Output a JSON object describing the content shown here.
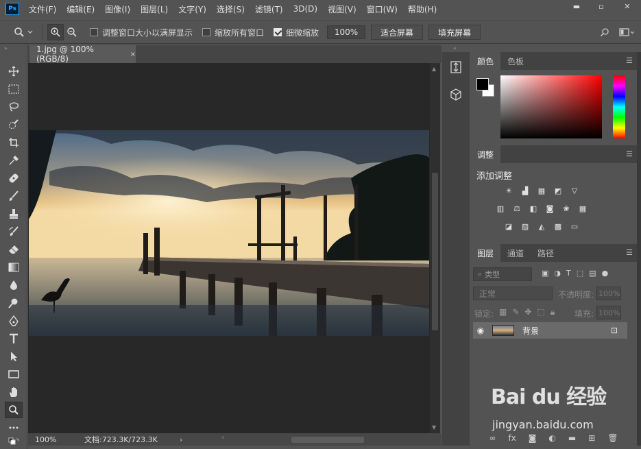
{
  "app": {
    "logo": "Ps"
  },
  "menu": [
    "文件(F)",
    "编辑(E)",
    "图像(I)",
    "图层(L)",
    "文字(Y)",
    "选择(S)",
    "滤镜(T)",
    "3D(D)",
    "视图(V)",
    "窗口(W)",
    "帮助(H)"
  ],
  "window_controls": {
    "minimize": "▬",
    "restore": "▫",
    "close": "✕"
  },
  "options": {
    "resize_windows": "调整窗口大小以满屏显示",
    "zoom_all": "缩放所有窗口",
    "scrubby_zoom": "细微缩放",
    "zoom_value": "100%",
    "fit_screen": "适合屏幕",
    "fill_screen": "填充屏幕",
    "resize_checked": false,
    "zoom_all_checked": false,
    "scrubby_checked": true
  },
  "document": {
    "tab_title": "1.jpg @ 100%(RGB/8)",
    "close": "×"
  },
  "status": {
    "zoom": "100%",
    "doc_size": "文档:723.3K/723.3K",
    "arrow": "›"
  },
  "panels": {
    "color_tabs": [
      "颜色",
      "色板"
    ],
    "adjust_tab": "调整",
    "adjust_title": "添加调整",
    "layers_tabs": [
      "图层",
      "通道",
      "路径"
    ],
    "filter_kind": "类型",
    "blend_mode": "正常",
    "opacity_label": "不透明度:",
    "opacity_value": "100%",
    "lock_label": "锁定:",
    "fill_label": "填充:",
    "fill_value": "100%",
    "layer_name": "背景"
  },
  "watermark": {
    "logo": "Bai du 经验",
    "url": "jingyan.baidu.com"
  },
  "colors": {
    "fg": "#000000",
    "bg": "#ffffff",
    "accent": "#31a8ff"
  }
}
